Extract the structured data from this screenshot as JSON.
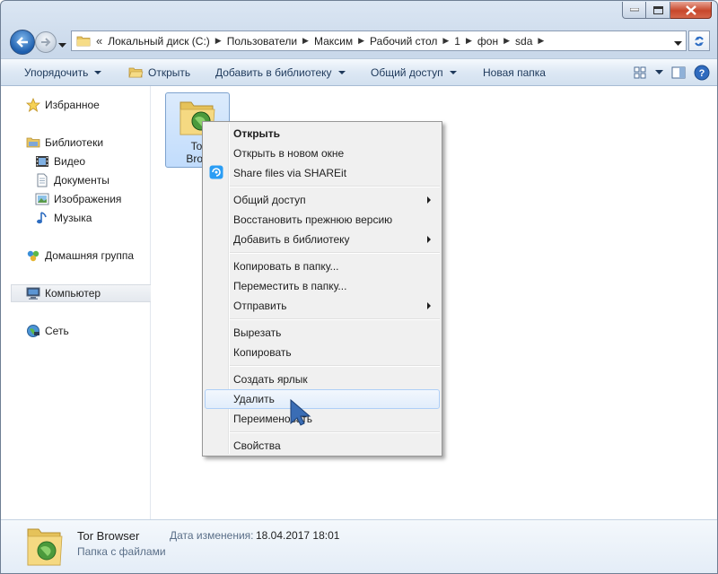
{
  "window": {
    "address": {
      "lead": "«",
      "crumbs": [
        "Локальный диск (C:)",
        "Пользователи",
        "Максим",
        "Рабочий стол",
        "1",
        "фон",
        "sda"
      ]
    }
  },
  "toolbar": {
    "organize": "Упорядочить",
    "open": "Открыть",
    "add_to_library": "Добавить в библиотеку",
    "share": "Общий доступ",
    "new_folder": "Новая папка"
  },
  "navpane": {
    "favorites": "Избранное",
    "libraries": "Библиотеки",
    "video": "Видео",
    "documents": "Документы",
    "images": "Изображения",
    "music": "Музыка",
    "homegroup": "Домашняя группа",
    "computer": "Компьютер",
    "network": "Сеть"
  },
  "content": {
    "file_label_line1": "Tor",
    "file_label_line2": "Brow"
  },
  "context_menu": {
    "open": "Открыть",
    "open_new_window": "Открыть в новом окне",
    "shareit": "Share files via SHAREit",
    "share": "Общий доступ",
    "restore": "Восстановить прежнюю версию",
    "add_library": "Добавить в библиотеку",
    "copy_to": "Копировать в папку...",
    "move_to": "Переместить в папку...",
    "send_to": "Отправить",
    "cut": "Вырезать",
    "copy": "Копировать",
    "create_shortcut": "Создать ярлык",
    "delete": "Удалить",
    "rename": "Переименовать",
    "properties": "Свойства"
  },
  "details": {
    "name": "Tor Browser",
    "type": "Папка с файлами",
    "date_label": "Дата изменения:",
    "date_value": "18.04.2017 18:01"
  },
  "colors": {
    "accent": "#1e395b",
    "hover_border": "#aecff7",
    "close_red": "#c7472b"
  },
  "icons": {
    "back": "arrow-left-icon",
    "forward": "arrow-right-icon",
    "refresh": "refresh-icon",
    "folder": "folder-icon",
    "star": "star-icon",
    "shareit": "shareit-icon"
  }
}
